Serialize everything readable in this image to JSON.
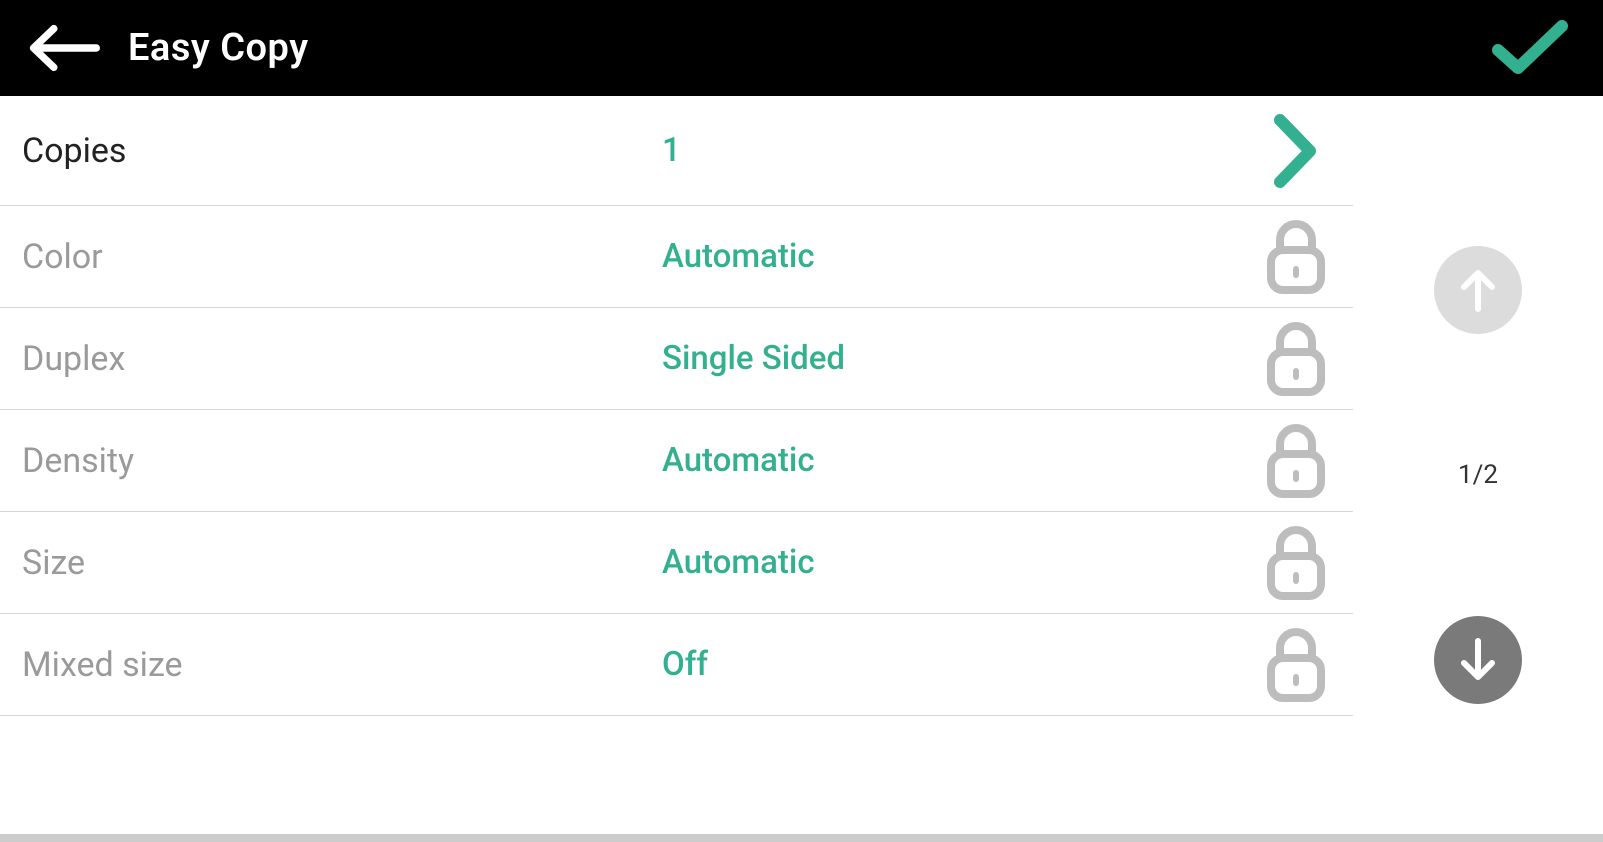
{
  "header": {
    "title": "Easy Copy"
  },
  "rows": [
    {
      "label": "Copies",
      "value": "1",
      "locked": false
    },
    {
      "label": "Color",
      "value": "Automatic",
      "locked": true
    },
    {
      "label": "Duplex",
      "value": "Single Sided",
      "locked": true
    },
    {
      "label": "Density",
      "value": "Automatic",
      "locked": true
    },
    {
      "label": "Size",
      "value": "Automatic",
      "locked": true
    },
    {
      "label": "Mixed size",
      "value": "Off",
      "locked": true
    }
  ],
  "pager": {
    "label": "1/2",
    "up_enabled": false,
    "down_enabled": true
  }
}
